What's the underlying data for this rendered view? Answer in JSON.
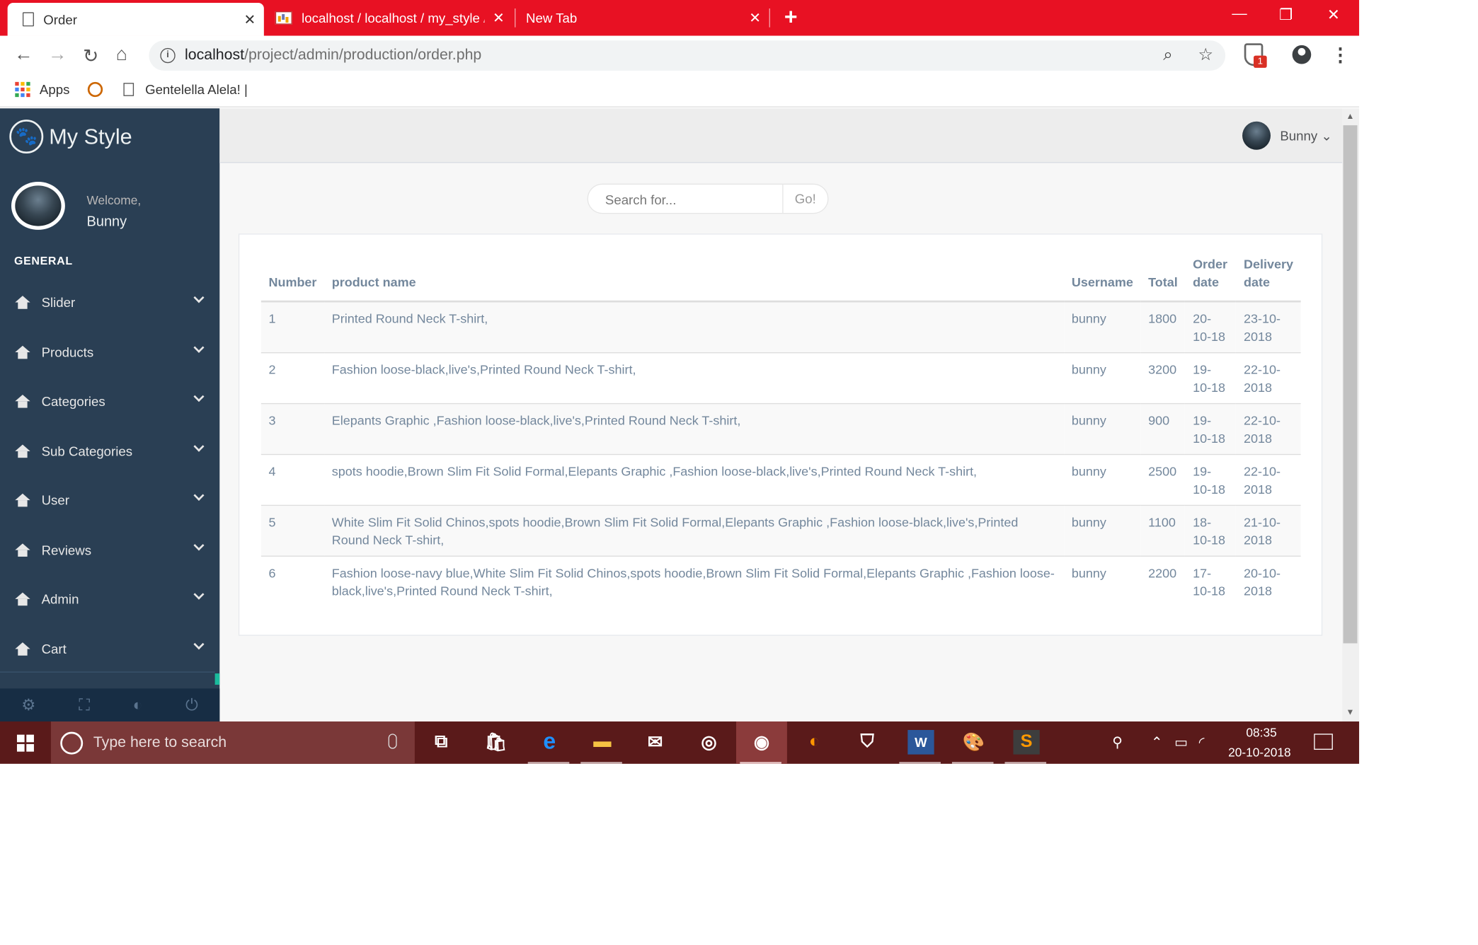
{
  "browser": {
    "tabs": [
      {
        "title": "Order",
        "close": "✕"
      },
      {
        "title": "localhost / localhost / my_style /",
        "close": "✕"
      },
      {
        "title": "New Tab",
        "close": "✕"
      }
    ],
    "new_tab": "+",
    "window_controls": {
      "minimize": "—",
      "restore": "❐",
      "close": "✕"
    },
    "url_host": "localhost",
    "url_path": "/project/admin/production/order.php",
    "extension_badge": "1",
    "bookmarks": [
      {
        "label": "Apps"
      },
      {
        "label": ""
      },
      {
        "label": "Gentelella Alela! |"
      }
    ]
  },
  "sidebar": {
    "brand": "My Style",
    "welcome": "Welcome,",
    "user": "Bunny",
    "section": "GENERAL",
    "items": [
      {
        "label": "Slider"
      },
      {
        "label": "Products"
      },
      {
        "label": "Categories"
      },
      {
        "label": "Sub Categories"
      },
      {
        "label": "User"
      },
      {
        "label": "Reviews"
      },
      {
        "label": "Admin"
      },
      {
        "label": "Cart"
      }
    ],
    "footer_icons": [
      "gear-icon",
      "fullscreen-icon",
      "eye-slash-icon",
      "power-icon"
    ]
  },
  "topnav": {
    "user": "Bunny ⌄"
  },
  "search": {
    "placeholder": "Search for...",
    "button": "Go!"
  },
  "table": {
    "headers": {
      "number": "Number",
      "product": "product name",
      "username": "Username",
      "total": "Total",
      "order_date_1": "Order",
      "order_date_2": "date",
      "delivery_date_1": "Delivery",
      "delivery_date_2": "date"
    },
    "rows": [
      {
        "number": "1",
        "product": "Printed Round Neck T-shirt,",
        "username": "bunny",
        "total": "1800",
        "order_date": "20-10-18",
        "delivery_date": "23-10-2018"
      },
      {
        "number": "2",
        "product": "Fashion loose-black,live's,Printed Round Neck T-shirt,",
        "username": "bunny",
        "total": "3200",
        "order_date": "19-10-18",
        "delivery_date": "22-10-2018"
      },
      {
        "number": "3",
        "product": "Elepants Graphic ,Fashion loose-black,live's,Printed Round Neck T-shirt,",
        "username": "bunny",
        "total": "900",
        "order_date": "19-10-18",
        "delivery_date": "22-10-2018"
      },
      {
        "number": "4",
        "product": "spots hoodie,Brown Slim Fit Solid Formal,Elepants Graphic ,Fashion loose-black,live's,Printed Round Neck T-shirt,",
        "username": "bunny",
        "total": "2500",
        "order_date": "19-10-18",
        "delivery_date": "22-10-2018"
      },
      {
        "number": "5",
        "product": "White Slim Fit Solid Chinos,spots hoodie,Brown Slim Fit Solid Formal,Elepants Graphic ,Fashion loose-black,live's,Printed Round Neck T-shirt,",
        "username": "bunny",
        "total": "1100",
        "order_date": "18-10-18",
        "delivery_date": "21-10-2018"
      },
      {
        "number": "6",
        "product": "Fashion loose-navy blue,White Slim Fit Solid Chinos,spots hoodie,Brown Slim Fit Solid Formal,Elepants Graphic ,Fashion loose-black,live's,Printed Round Neck T-shirt,",
        "username": "bunny",
        "total": "2200",
        "order_date": "17-10-18",
        "delivery_date": "20-10-2018"
      }
    ]
  },
  "taskbar": {
    "search_placeholder": "Type here to search",
    "time": "08:35",
    "date": "20-10-2018"
  },
  "colors": {
    "chrome_red": "#e81123",
    "sidebar": "#2a3f54",
    "taskbar": "#5a1a1a",
    "accent": "#1abb9c"
  }
}
